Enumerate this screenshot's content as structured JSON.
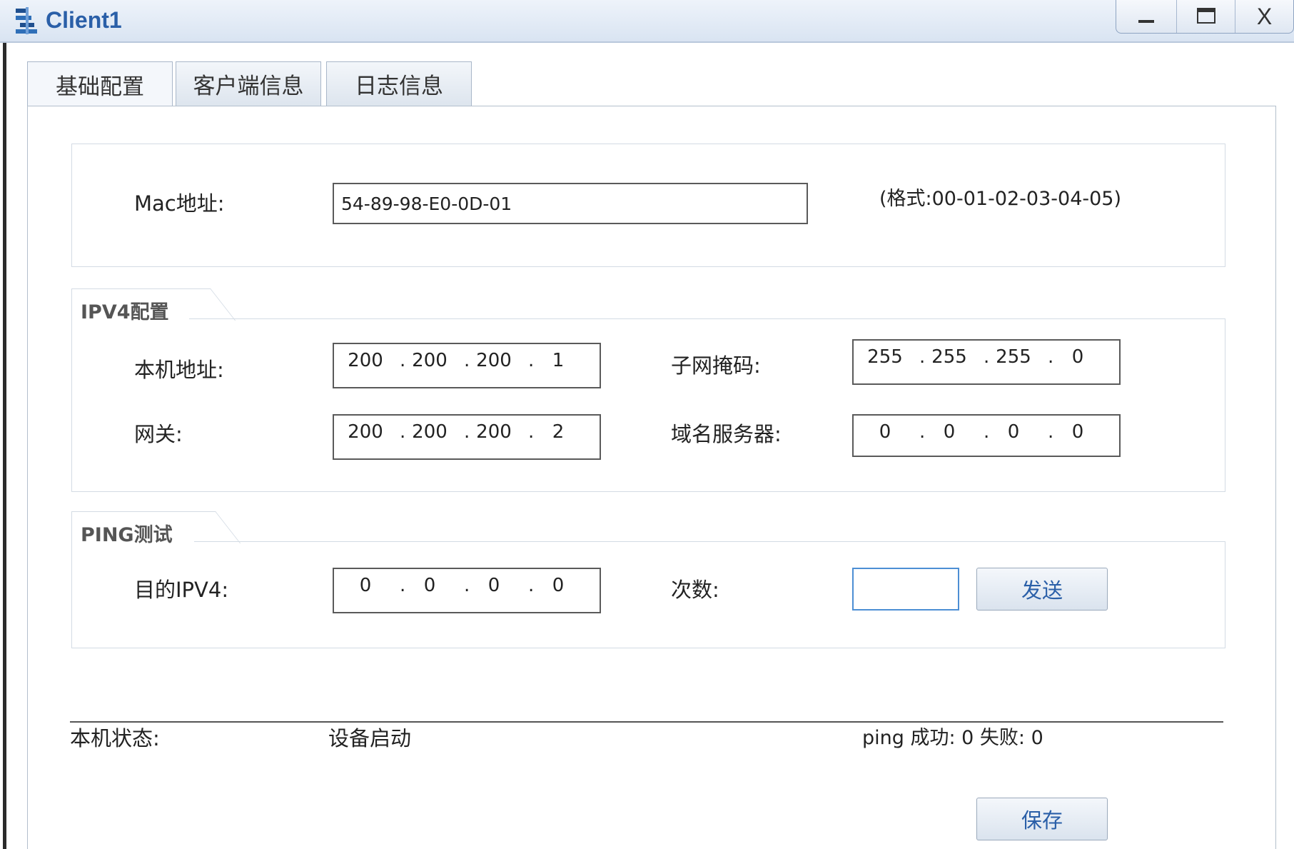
{
  "window": {
    "title": "Client1",
    "minimize_glyph": "_",
    "maximize_glyph": "□",
    "close_glyph": "X",
    "icon": "network-client-icon"
  },
  "tabs": [
    {
      "label": "基础配置",
      "active": true
    },
    {
      "label": "客户端信息",
      "active": false
    },
    {
      "label": "日志信息",
      "active": false
    }
  ],
  "mac": {
    "label": "Mac地址:",
    "value": "54-89-98-E0-0D-01",
    "hint": "(格式:00-01-02-03-04-05)"
  },
  "ipv4": {
    "group_title": "IPV4配置",
    "local_label": "本机地址:",
    "local": [
      "200",
      "200",
      "200",
      "1"
    ],
    "mask_label": "子网掩码:",
    "mask": [
      "255",
      "255",
      "255",
      "0"
    ],
    "gateway_label": "网关:",
    "gateway": [
      "200",
      "200",
      "200",
      "2"
    ],
    "dns_label": "域名服务器:",
    "dns": [
      "0",
      "0",
      "0",
      "0"
    ]
  },
  "ping": {
    "group_title": "PING测试",
    "dest_label": "目的IPV4:",
    "dest": [
      "0",
      "0",
      "0",
      "0"
    ],
    "count_label": "次数:",
    "count_value": "",
    "send_label": "发送"
  },
  "status": {
    "label": "本机状态:",
    "value": "设备启动",
    "ping_result": "ping 成功: 0 失败: 0"
  },
  "save_label": "保存",
  "colors": {
    "title_text": "#2a5fa8",
    "button_text": "#2a5fa8",
    "focus_border": "#4d8fd4"
  }
}
